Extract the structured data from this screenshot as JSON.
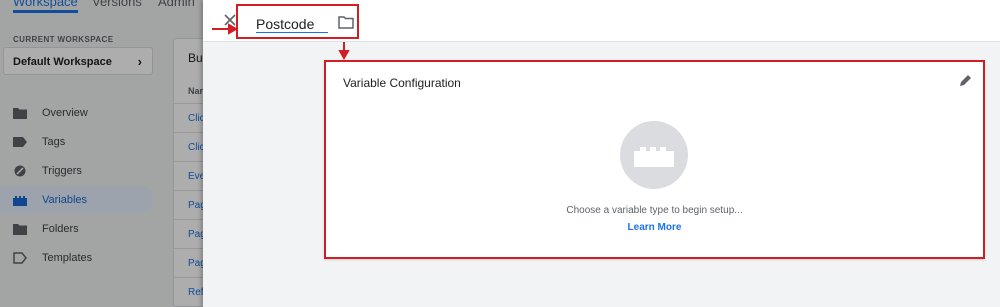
{
  "app": {
    "top_tabs": [
      "Workspace",
      "Versions",
      "Admin"
    ],
    "workspace_label": "CURRENT WORKSPACE",
    "workspace_name": "Default Workspace",
    "nav": [
      {
        "label": "Overview",
        "icon": "folder-icon"
      },
      {
        "label": "Tags",
        "icon": "tag-icon"
      },
      {
        "label": "Triggers",
        "icon": "trigger-icon"
      },
      {
        "label": "Variables",
        "icon": "variables-icon"
      },
      {
        "label": "Folders",
        "icon": "folder-icon"
      },
      {
        "label": "Templates",
        "icon": "template-icon"
      }
    ],
    "panel": {
      "title": "Bu",
      "header": "Nar",
      "rows": [
        "Clic",
        "Clic",
        "Eve",
        "Pag",
        "Pag",
        "Pag",
        "Ref"
      ]
    }
  },
  "sheet": {
    "variable_name": "Postcode",
    "card_title": "Variable Configuration",
    "prompt": "Choose a variable type to begin setup...",
    "learn_more": "Learn More"
  },
  "colors": {
    "accent": "#1a73e8",
    "annotation": "#d31d24"
  }
}
